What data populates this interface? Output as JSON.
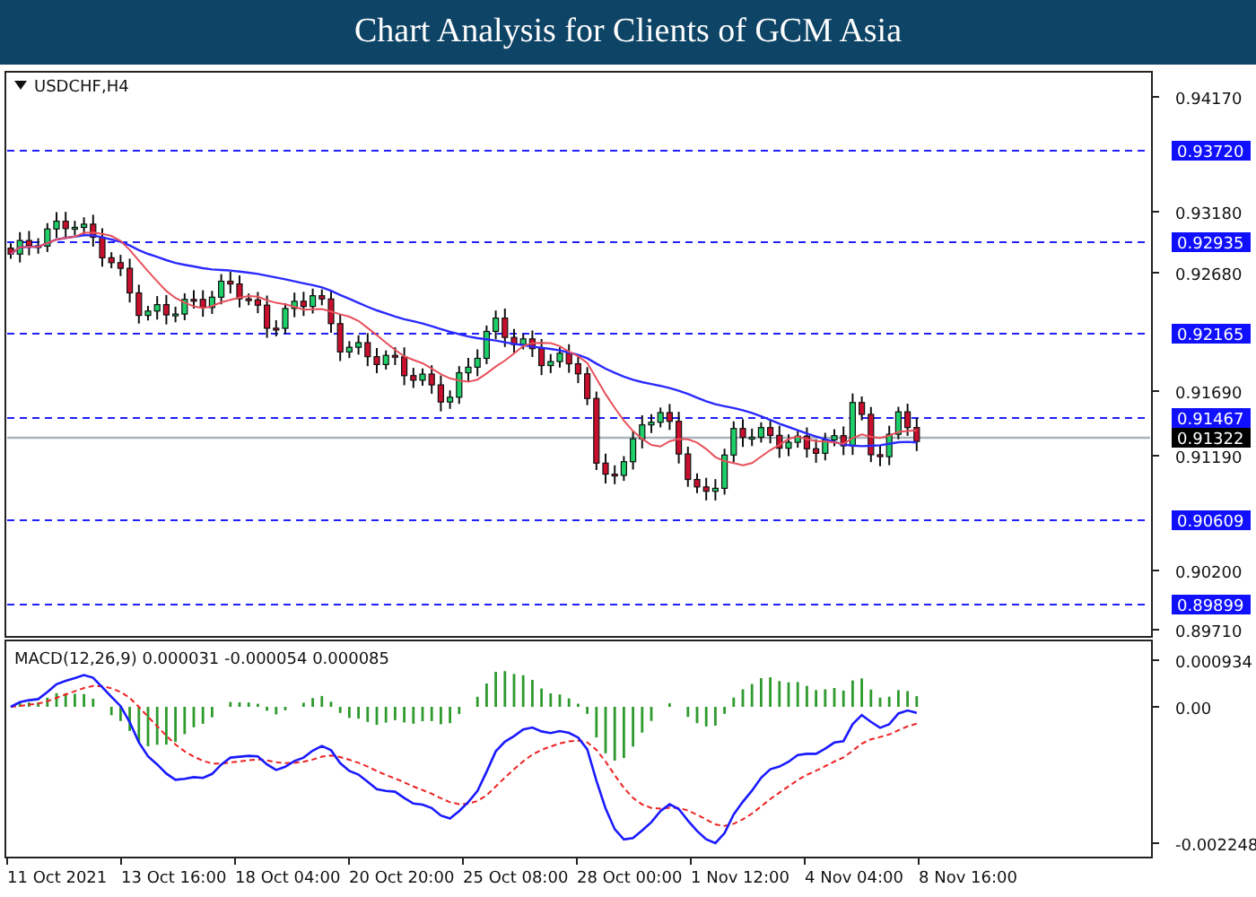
{
  "header": {
    "title": "Chart Analysis for Clients of GCM Asia"
  },
  "chart": {
    "symbol": "USDCHF,H4",
    "price_scale": [
      "0.94170",
      "0.93180",
      "0.92680",
      "0.91690",
      "0.91190",
      "0.90200",
      "0.89710"
    ],
    "levels": [
      "0.93720",
      "0.92935",
      "0.92165",
      "0.91467",
      "0.90609",
      "0.89899"
    ],
    "current_price": "0.91322"
  },
  "macd": {
    "label": "MACD(12,26,9) 0.000031 -0.000054 0.000085",
    "scale": [
      "0.000934",
      "0.00",
      "-0.002248"
    ]
  },
  "time_axis": [
    "11 Oct 2021",
    "13 Oct 16:00",
    "18 Oct 04:00",
    "20 Oct 20:00",
    "25 Oct 08:00",
    "28 Oct 00:00",
    "1 Nov 12:00",
    "4 Nov 04:00",
    "8 Nov 16:00"
  ]
}
